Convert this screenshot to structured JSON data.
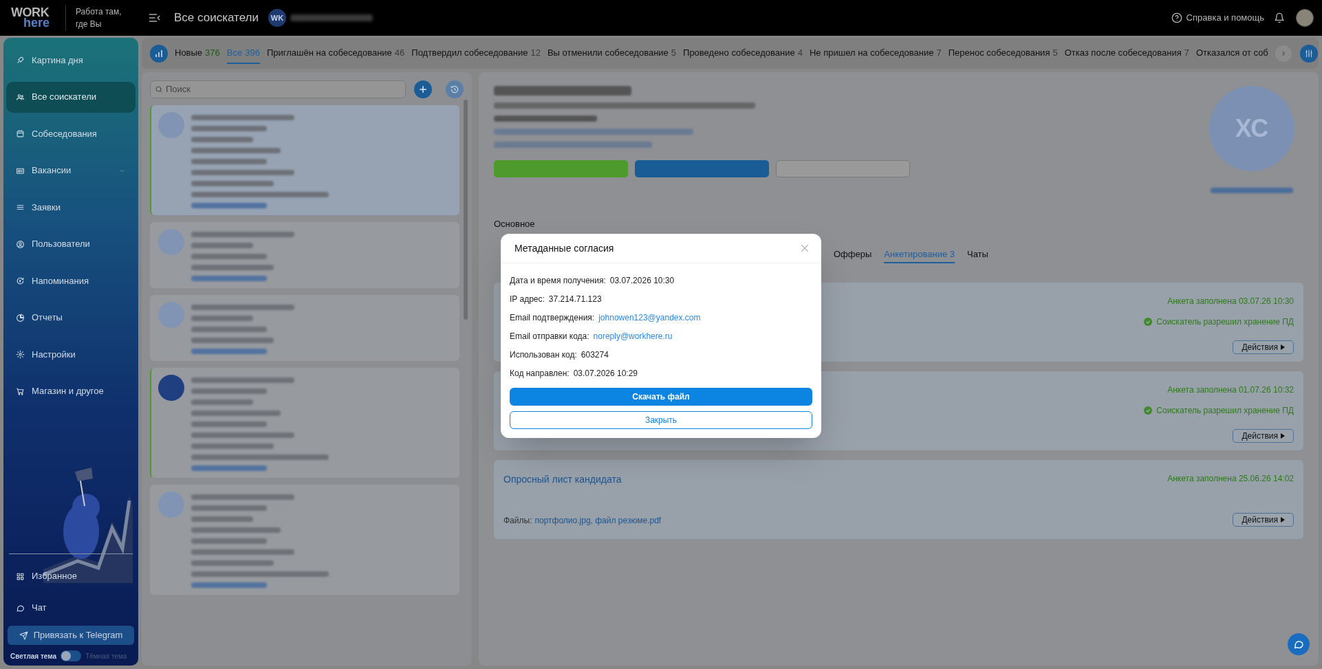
{
  "header": {
    "logo_top": "WORK",
    "logo_bottom": "here",
    "slogan": "Работа там, где Вы",
    "title": "Все соискатели",
    "org_initials": "WK",
    "help": "Справка и помощь"
  },
  "sidebar": {
    "items": [
      {
        "label": "Картина дня",
        "selected": false,
        "has_submenu": false
      },
      {
        "label": "Все соискатели",
        "selected": true,
        "has_submenu": false
      },
      {
        "label": "Собеседования",
        "selected": false,
        "has_submenu": false
      },
      {
        "label": "Вакансии",
        "selected": false,
        "has_submenu": true
      },
      {
        "label": "Заявки",
        "selected": false,
        "has_submenu": false
      },
      {
        "label": "Пользователи",
        "selected": false,
        "has_submenu": false
      },
      {
        "label": "Напоминания",
        "selected": false,
        "has_submenu": false
      },
      {
        "label": "Отчеты",
        "selected": false,
        "has_submenu": false
      },
      {
        "label": "Настройки",
        "selected": false,
        "has_submenu": false
      },
      {
        "label": "Магазин и другое",
        "selected": false,
        "has_submenu": false
      }
    ],
    "bottom_items": [
      {
        "label": "Избранное"
      },
      {
        "label": "Чат"
      }
    ],
    "telegram_button": "Привязать к Telegram",
    "theme": {
      "light_label": "Светлая тема",
      "dark_label": "Тёмная тема",
      "dark": false
    }
  },
  "status_tabs": [
    {
      "label": "Новые",
      "count": "376",
      "selected": false,
      "color": "#1f5c10"
    },
    {
      "label": "Все",
      "count": "396",
      "selected": true,
      "color": "#1d5f9e"
    },
    {
      "label": "Приглашён на собеседование",
      "count": "46",
      "selected": false,
      "color": "#3a3a3a"
    },
    {
      "label": "Подтвердил собеседование",
      "count": "12",
      "selected": false,
      "color": "#3a3a3a"
    },
    {
      "label": "Вы отменили собеседование",
      "count": "5",
      "selected": false,
      "color": "#3a3a3a"
    },
    {
      "label": "Проведено собеседование",
      "count": "4",
      "selected": false,
      "color": "#3a3a3a"
    },
    {
      "label": "Не пришел на собеседование",
      "count": "7",
      "selected": false,
      "color": "#3a3a3a"
    },
    {
      "label": "Перенос собеседования",
      "count": "5",
      "selected": false,
      "color": "#3a3a3a"
    },
    {
      "label": "Отказ после собеседования",
      "count": "7",
      "selected": false,
      "color": "#3a3a3a"
    },
    {
      "label": "Отказался от соб",
      "selected": false
    }
  ],
  "search": {
    "placeholder": "Поиск"
  },
  "candidates": [
    {
      "kind": "long",
      "selected": true,
      "flagged": true
    },
    {
      "kind": "short",
      "selected": false,
      "flagged": false
    },
    {
      "kind": "short",
      "selected": false,
      "flagged": false
    },
    {
      "kind": "long",
      "selected": false,
      "flagged": true
    },
    {
      "kind": "long",
      "selected": false,
      "flagged": false
    }
  ],
  "profile": {
    "avatar_initials": "ХС",
    "section": "Основное",
    "tabs": [
      {
        "label": "Офферы",
        "selected": false
      },
      {
        "label": "Анкетирование 3",
        "selected": true
      },
      {
        "label": "Чаты",
        "selected": false
      }
    ]
  },
  "surveys": [
    {
      "filled": "Анкета заполнена 03.07.26 10:30",
      "consent": "Соискатель разрешил хранение ПД",
      "action": "Действия"
    },
    {
      "filled": "Анкета заполнена 01.07.26 10:32",
      "consent": "Соискатель разрешил хранение ПД",
      "action": "Действия"
    },
    {
      "title": "Опросный лист кандидата",
      "filled": "Анкета заполнена 25.06.26 14:02",
      "files_label": "Файлы:",
      "files": "портфолио.jpg, файл резюме.pdf",
      "action": "Действия"
    }
  ],
  "modal": {
    "title": "Метаданные согласия",
    "rows": [
      {
        "label": "Дата и время получения:",
        "value": "03.07.2026 10:30",
        "kind": "text"
      },
      {
        "label": "IP адрес:",
        "value": "37.214.71.123",
        "kind": "text"
      },
      {
        "label": "Email подтверждения:",
        "value": "johnowen123@yandex.com",
        "kind": "link"
      },
      {
        "label": "Email отправки кода:",
        "value": "noreply@workhere.ru",
        "kind": "link"
      },
      {
        "label": "Использован код:",
        "value": "603274",
        "kind": "text"
      },
      {
        "label": "Код направлен:",
        "value": "03.07.2026 10:29",
        "kind": "text"
      }
    ],
    "primary_button": "Скачать файл",
    "secondary_button": "Закрыть"
  }
}
